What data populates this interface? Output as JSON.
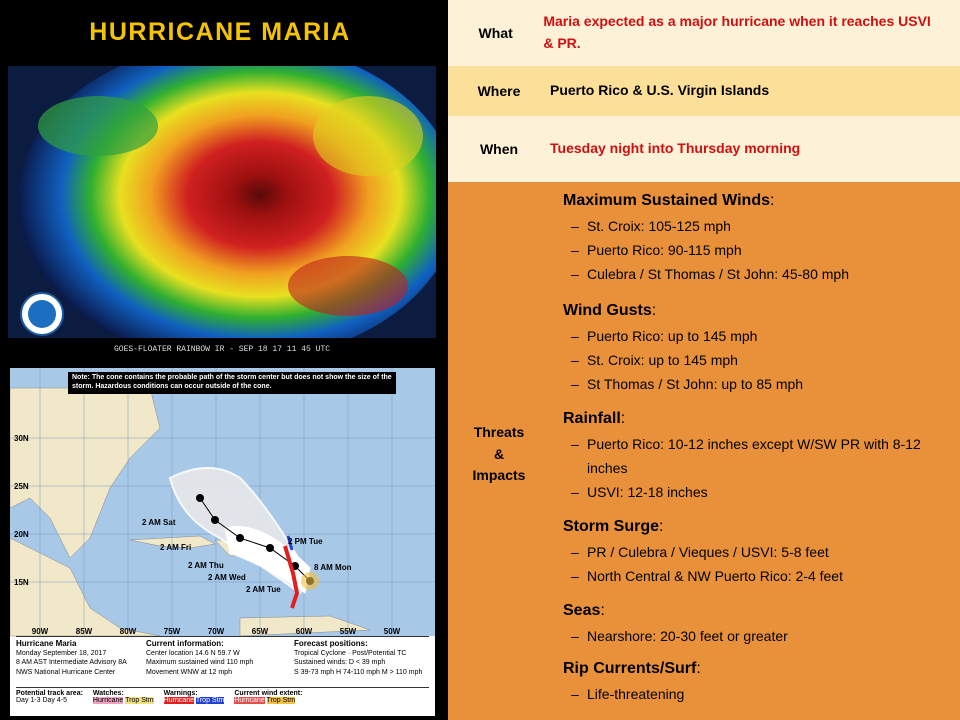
{
  "left": {
    "title": "HURRICANE MARIA",
    "satellite_caption": "GOES-FLOATER RAINBOW IR - SEP 18 17 11 45 UTC",
    "map_note": "Note: The cone contains the probable path of the storm center but does not show the size of the storm. Hazardous conditions can occur outside of the cone.",
    "map_labels": {
      "lat": [
        "30N",
        "25N",
        "20N",
        "15N"
      ],
      "lon": [
        "90W",
        "85W",
        "80W",
        "75W",
        "70W",
        "65W",
        "60W",
        "55W",
        "50W"
      ],
      "forecast": [
        "2 AM Sat",
        "2 AM Fri",
        "2 AM Thu",
        "2 AM Wed",
        "2 AM Tue",
        "2 PM Tue",
        "8 AM Mon"
      ]
    },
    "map_info": {
      "storm_name": "Hurricane Maria",
      "issued": "Monday September 18, 2017",
      "advisory": "8 AM AST Intermediate Advisory 8A",
      "center": "NWS National Hurricane Center",
      "current_title": "Current information:",
      "location": "Center location 14.6 N 59.7 W",
      "max_wind": "Maximum sustained wind 110 mph",
      "movement": "Movement WNW at 12 mph",
      "positions_title": "Forecast positions:",
      "tropical_cyclone": "Tropical Cyclone",
      "post_tc": "Post/Potential TC",
      "sustained_title": "Sustained winds:",
      "d": "D < 39 mph",
      "s": "S 39-73 mph",
      "h": "H 74-110 mph",
      "m": "M > 110 mph",
      "potential_track": "Potential track area:",
      "day13": "Day 1-3",
      "day45": "Day 4-5",
      "watches": "Watches:",
      "warnings": "Warnings:",
      "current_extent": "Current wind extent:",
      "hurricane": "Hurricane",
      "trop_stm": "Trop Stm"
    }
  },
  "rows": {
    "what_label": "What",
    "what_value": "Maria expected as a major hurricane when it reaches USVI & PR.",
    "where_label": "Where",
    "where_value": "Puerto Rico & U.S. Virgin Islands",
    "when_label": "When",
    "when_value": "Tuesday night into Thursday morning",
    "threats_label_1": "Threats",
    "threats_label_2": "&",
    "threats_label_3": "Impacts"
  },
  "sections": [
    {
      "title": "Maximum Sustained Winds",
      "items": [
        "St. Croix: 105-125 mph",
        "Puerto Rico: 90-115 mph",
        "Culebra / St Thomas / St John: 45-80 mph"
      ]
    },
    {
      "title": "Wind Gusts",
      "items": [
        "Puerto Rico: up to 145 mph",
        "St. Croix: up to 145 mph",
        "St Thomas / St John: up to 85 mph"
      ]
    },
    {
      "title": "Rainfall",
      "items": [
        "Puerto Rico: 10-12 inches except W/SW PR with 8-12 inches",
        "USVI: 12-18 inches"
      ]
    },
    {
      "title": "Storm Surge",
      "items": [
        "PR / Culebra / Vieques / USVI: 5-8 feet",
        "North Central & NW Puerto Rico: 2-4 feet"
      ]
    },
    {
      "title": "Seas",
      "items": [
        "Nearshore: 20-30 feet or greater"
      ]
    },
    {
      "title": "Rip Currents/Surf",
      "items": [
        "Life-threatening"
      ]
    }
  ],
  "colors": {
    "title": "#f5c400",
    "red_text": "#d01010",
    "light_row": "#fdf1d8",
    "where_row": "#fcdf98",
    "threats_bg": "#e8913a"
  }
}
